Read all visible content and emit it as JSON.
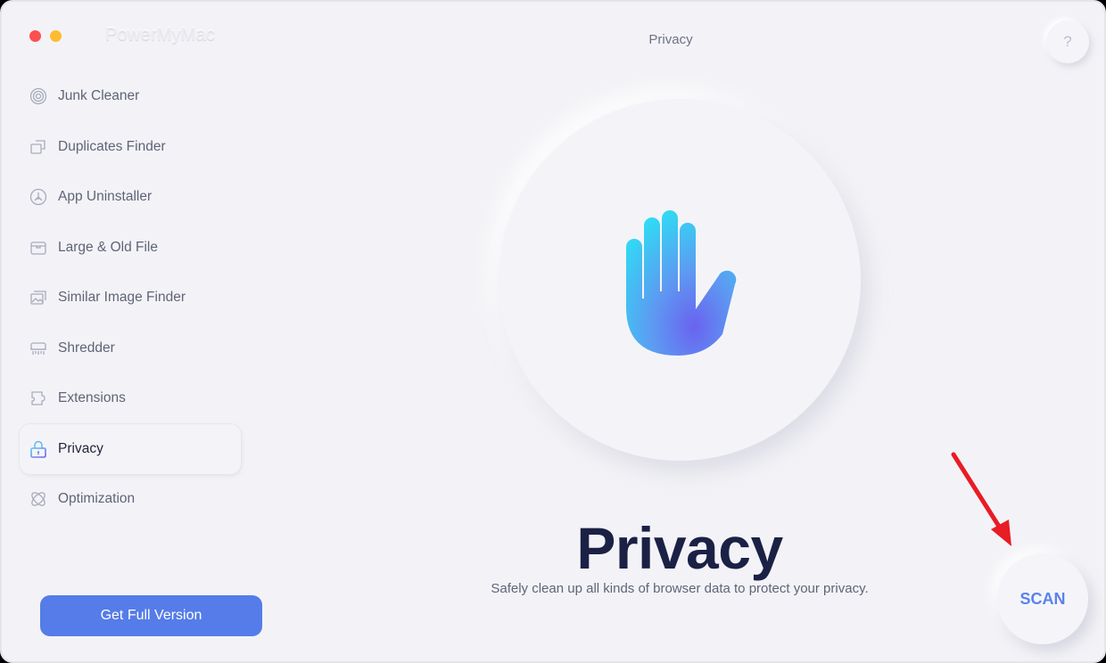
{
  "window": {
    "app_name": "PowerMyMac",
    "traffic_lights": [
      {
        "name": "close",
        "color": "#fc5050"
      },
      {
        "name": "minimize",
        "color": "#fdbc30"
      }
    ]
  },
  "header": {
    "title": "Privacy",
    "help_label": "?"
  },
  "sidebar": {
    "items": [
      {
        "label": "Junk Cleaner",
        "icon": "junk-cleaner-icon",
        "active": false
      },
      {
        "label": "Duplicates Finder",
        "icon": "duplicates-icon",
        "active": false
      },
      {
        "label": "App Uninstaller",
        "icon": "app-uninstaller-icon",
        "active": false
      },
      {
        "label": "Large & Old File",
        "icon": "archive-box-icon",
        "active": false
      },
      {
        "label": "Similar Image Finder",
        "icon": "image-icon",
        "active": false
      },
      {
        "label": "Shredder",
        "icon": "shredder-icon",
        "active": false
      },
      {
        "label": "Extensions",
        "icon": "puzzle-icon",
        "active": false
      },
      {
        "label": "Privacy",
        "icon": "lock-icon",
        "active": true
      },
      {
        "label": "Optimization",
        "icon": "orbit-icon",
        "active": false
      }
    ],
    "cta_label": "Get Full Version"
  },
  "main": {
    "hero_icon": "raised-hand-icon",
    "title": "Privacy",
    "description": "Safely clean up all kinds of browser data to protect your privacy.",
    "scan_label": "SCAN"
  },
  "annotation": {
    "arrow_color": "#e81c24"
  },
  "colors": {
    "accent": "#557ce8",
    "scan_text": "#5a82ee",
    "title": "#1b2145",
    "background": "#f3f3f7"
  }
}
